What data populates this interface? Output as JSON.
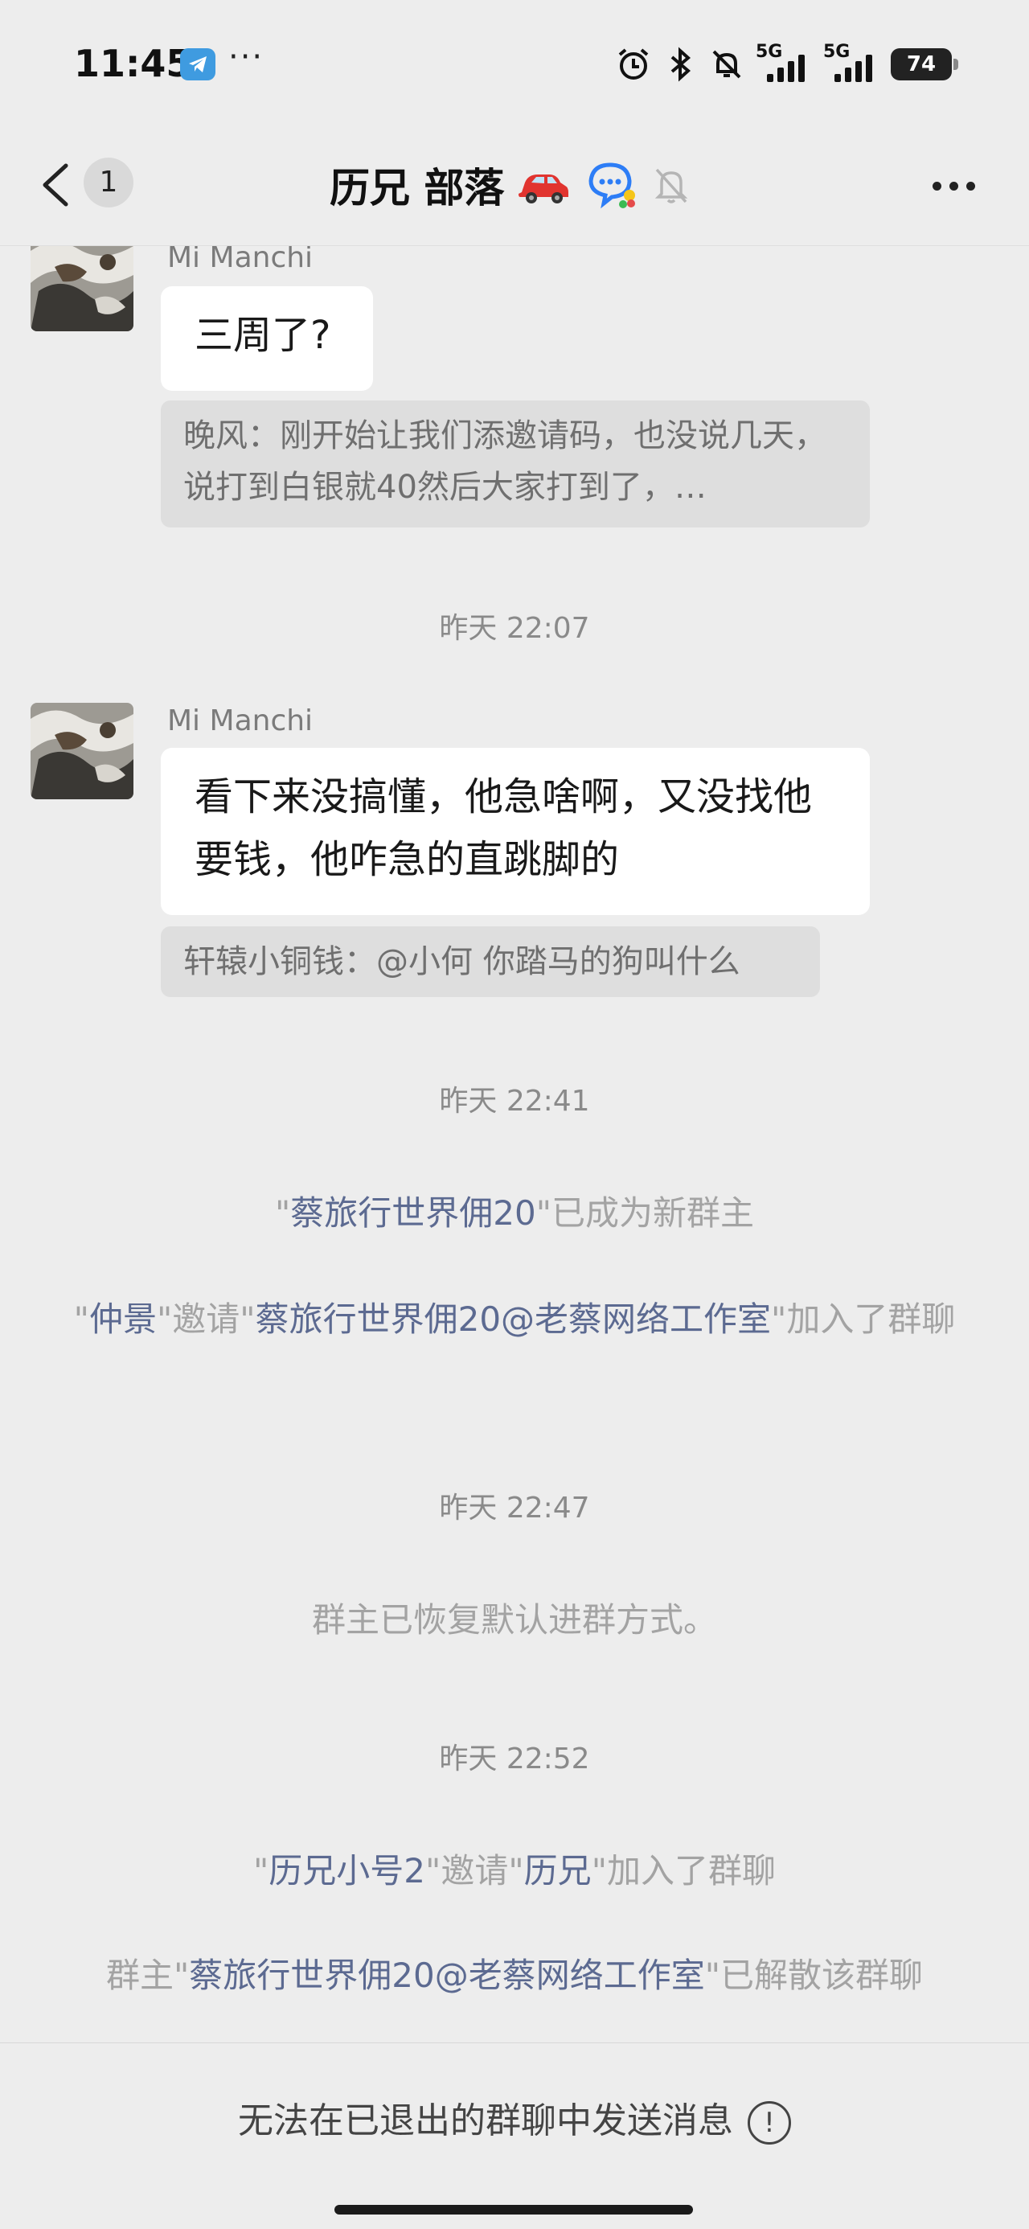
{
  "status_bar": {
    "time": "11:45",
    "more": "···",
    "network1_label": "5G",
    "network2_label": "5G",
    "battery": "74"
  },
  "header": {
    "unread_count": "1",
    "title": "历兄 部落"
  },
  "messages": [
    {
      "sender": "Mi Manchi",
      "text": "三周了?",
      "quote": "晚风：刚开始让我们添邀请码，也没说几天，说打到白银就40然后大家打到了，…"
    },
    {
      "sender": "Mi Manchi",
      "text": "看下来没搞懂，他急啥啊，又没找他要钱，他咋急的直跳脚的",
      "quote": "轩辕小铜钱：@小何 你踏马的狗叫什么"
    }
  ],
  "timestamps": [
    "昨天 22:07",
    "昨天 22:41",
    "昨天 22:47",
    "昨天 22:52"
  ],
  "system_messages": {
    "new_owner": {
      "q1": "\"",
      "name": "蔡旅行世界佣20",
      "rest": "\"已成为新群主"
    },
    "invite1": {
      "q1": "\"",
      "inviter": "仲景",
      "mid": "\"邀请\"",
      "invitee": "蔡旅行世界佣20@老蔡网络工作室",
      "rest": "\"加入了群聊"
    },
    "restore": "群主已恢复默认进群方式。",
    "invite2": {
      "q1": "\"",
      "inviter": "历兄小号2",
      "mid": "\"邀请\"",
      "invitee": "历兄",
      "rest": "\"加入了群聊"
    },
    "dissolve": {
      "pre": "群主\"",
      "name": "蔡旅行世界佣20@老蔡网络工作室",
      "rest": "\"已解散该群聊"
    }
  },
  "footer": {
    "text": "无法在已退出的群聊中发送消息",
    "icon": "!"
  },
  "colors": {
    "background": "#ededed",
    "bubble": "#ffffff",
    "quote": "#dedede",
    "highlight_name": "#5c6a91",
    "system_text": "#a3a3a3"
  }
}
